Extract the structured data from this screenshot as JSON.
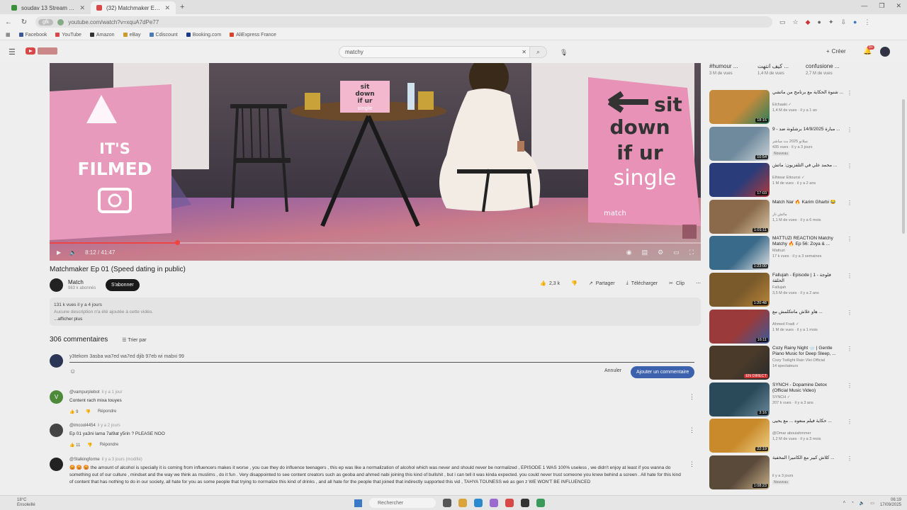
{
  "browser": {
    "tabs": [
      {
        "title": "soudav 13 Stream - Watch Li",
        "active": false,
        "favicon_color": "#3a8f3a"
      },
      {
        "title": "(32) Matchmaker Ep 01 (Speed",
        "active": true,
        "favicon_color": "#d94848"
      }
    ],
    "url": "youtube.com/watch?v=xquA7dPe77",
    "url_pill": "gfk",
    "bookmarks": [
      {
        "label": "Facebook",
        "color": "#3b5998"
      },
      {
        "label": "YouTube",
        "color": "#d94848"
      },
      {
        "label": "Amazon",
        "color": "#333333"
      },
      {
        "label": "eBay",
        "color": "#c99a2e"
      },
      {
        "label": "Cdiscount",
        "color": "#4a7ab7"
      },
      {
        "label": "Booking.com",
        "color": "#1b3a8a"
      },
      {
        "label": "AliExpress France",
        "color": "#d8442a"
      }
    ]
  },
  "youtube": {
    "search_query": "matchy",
    "create_label": "Créer",
    "notifications_count": "9+"
  },
  "video": {
    "current_time": "8:12",
    "duration": "41:47",
    "progress": 0.196,
    "title": "Matchmaker Ep 01 (Speed dating in public)",
    "scene_texts": {
      "left_sign_1": "IT'S",
      "left_sign_2": "FILMED",
      "mid_sign_1": "sit",
      "mid_sign_2": "down",
      "mid_sign_3": "if ur",
      "mid_sign_4": "single",
      "right_sign_1": "sit",
      "right_sign_2": "down",
      "right_sign_3": "if ur",
      "right_sign_4": "single",
      "brand": "match"
    }
  },
  "channel": {
    "name": "Match",
    "subscribers": "983 k abonnés",
    "subscribe_label": "S'abonner"
  },
  "actions": {
    "likes": "2,3 k",
    "share": "Partager",
    "download": "Télécharger",
    "clip": "Clip"
  },
  "description": {
    "stats": "131 k vues  il y a 4 jours",
    "text": "Aucune description n'a été ajoutée à cette vidéo.",
    "more": "...afficher plus"
  },
  "comments": {
    "count": "306 commentaires",
    "sort": "Trier par",
    "draft": "y3tekom 3asba wa7ed wa7ed djib 97eb wi mabxi 99",
    "cancel": "Annuler",
    "submit": "Ajouter un commentaire",
    "items": [
      {
        "initial": "V",
        "color": "#4f8a3a",
        "author": "@vampurplebot",
        "time": "il y a 1 jour",
        "text": "Content rach mixa touyes",
        "likes": "9",
        "reply": "Répondre"
      },
      {
        "initial": "",
        "color": "#444444",
        "author": "@imcool4454",
        "time": "il y a 2 jours",
        "text": "Ep 01 ya3ni lama 7al9at y5rin ? PLEASE NOO",
        "likes": "11",
        "reply": "Répondre"
      },
      {
        "initial": "",
        "color": "#222222",
        "author": "@Stalkingforme",
        "time": "il y a 3 jours (modifié)",
        "text": "😡 😡 😡 the amount of alcohol is specially it is coming from influencers makes it worse , you cue they do influence teenagers , this ep was like a normalization of alcohol which was never and should never be normalized , EPISODE 1 WAS 100% useless , we didn't enjoy at least if you wanna do something out of our culture , mindset and the way we think as muslims , do it fun . Very disappointed to see content creators such as geoba and ahmed nabi joining this kind of bullshit , but i can tell it was kinda expected. you could never trust someone you knew behind a screen . All hate for this kind of content that has nothing to do in our society, all hate for you as some people that trying to normalize this kind of drinks , and all hate for the people that joined that indirectly supported this vid , TAHYA TOUNESS wé as gen z WE WON'T BE INFLUENCED"
      }
    ]
  },
  "chips": [
    {
      "title": "#humour ...",
      "sub": "3 M de vues"
    },
    {
      "title": "كيف انتهت ...",
      "sub": "1,4 M de vues"
    },
    {
      "title": "confusione ...",
      "sub": "2,7 M de vues"
    }
  ],
  "recommendations": [
    {
      "title": "شنوة الحكاية مع برنامج من ماتشي ...",
      "channel": "Elchaaki ✓",
      "stats": "1,4 M de vues · il y a 1 an",
      "duration": "18:16",
      "badge": "",
      "colors": [
        "#c58a3c",
        "#2a7f5a"
      ]
    },
    {
      "title": "9 - مبارة 14/9/2025 برشلونة ضد ...",
      "channel": "ميلانو 2025 بث مباشر",
      "stats": "435 vues · il y a 3 jours",
      "duration": "10:54",
      "badge": "Nouveau",
      "colors": [
        "#6f8a9c",
        "#cdd5da"
      ]
    },
    {
      "title": "محمد علي في التلفزيون: ماتش ...",
      "channel": "Elhiwar Ettounsi ✓",
      "stats": "1 M de vues · il y a 2 ans",
      "duration": "17:03",
      "badge": "",
      "colors": [
        "#2a3c7a",
        "#b03a3a"
      ]
    },
    {
      "title": "Match Nar 🔥 Karim Gharbi 😂",
      "channel": "ماتش نار",
      "stats": "1,1 M de vues · il y a 6 mois",
      "duration": "1:01:11",
      "badge": "",
      "colors": [
        "#8a6a4a",
        "#d9c9a8"
      ]
    },
    {
      "title": "MATTUZI REACTION Matchy Matchy 🔥 Ep 56: Zoya & ...",
      "channel": "Mattuzi",
      "stats": "17 k vues · il y a 3 semaines",
      "duration": "1:23:00",
      "badge": "",
      "colors": [
        "#3a6a8a",
        "#e4e4e4"
      ]
    },
    {
      "title": "Fallujah - Episode | 1 فلوجة - الحلقة",
      "channel": "Fallujah",
      "stats": "3,5 M de vues · il y a 2 ans",
      "duration": "1:20:48",
      "badge": "",
      "colors": [
        "#7a5a2a",
        "#b8863c"
      ]
    },
    {
      "title": "هاو علاش ماتتكلمش مع ...",
      "channel": "Ahmed Fradi ✓",
      "stats": "1 M de vues · il y a 1 mois",
      "duration": "16:11",
      "badge": "",
      "colors": [
        "#9a3a3a",
        "#3a5a9a"
      ]
    },
    {
      "title": "Cozy Rainy Night 🌧️ | Gentle Piano Music for Deep Sleep, ...",
      "channel": "Cozy Twilight Rain Vlei Official",
      "stats": "14 spectateurs",
      "duration": "EN DIRECT",
      "badge": "",
      "colors": [
        "#4a3a2a",
        "#2a2a2a"
      ]
    },
    {
      "title": "SYNCH - Dopamine Detox (Official Music Video)",
      "channel": "SYNCH ✓",
      "stats": "207 k vues · il y a 3 ans",
      "duration": "3:16",
      "badge": "",
      "colors": [
        "#2a4a5a",
        "#6a8a9a"
      ]
    },
    {
      "title": "حكاية فيلم منعوه ... مع يحيى ...",
      "channel": "@Omar abouiahmmer",
      "stats": "1,2 M de vues · il y a 3 mois",
      "duration": "22:19",
      "badge": "",
      "colors": [
        "#c88a2a",
        "#f0d28a"
      ]
    },
    {
      "title": "كلاش كبير مع الكاميرا المخفية ...",
      "channel": "",
      "stats": "il y a 3 jours",
      "duration": "1:08:23",
      "badge": "Nouveau",
      "colors": [
        "#5a4a3a",
        "#c8b08a"
      ]
    }
  ],
  "taskbar": {
    "weather_temp": "18°C",
    "weather_desc": "Ensoleillé",
    "search": "Rechercher",
    "time": "06:19",
    "date": "17/09/2025"
  }
}
